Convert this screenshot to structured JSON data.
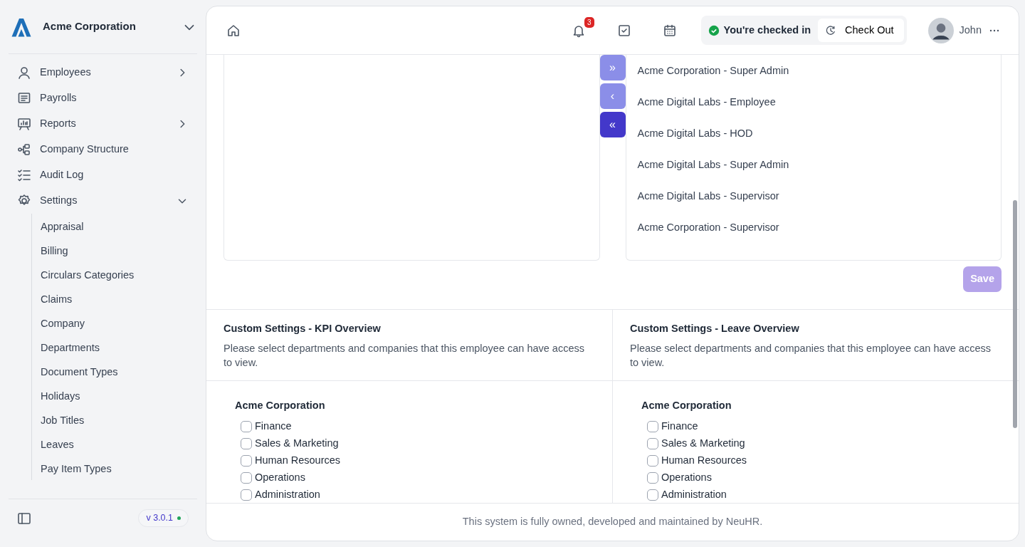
{
  "brand": {
    "name": "Acme Corporation"
  },
  "sidebar": {
    "items": [
      {
        "label": "Employees",
        "expanded": false
      },
      {
        "label": "Payrolls"
      },
      {
        "label": "Reports",
        "expanded": false
      },
      {
        "label": "Company Structure"
      },
      {
        "label": "Audit Log"
      },
      {
        "label": "Settings",
        "expanded": true,
        "children": [
          {
            "label": "Appraisal"
          },
          {
            "label": "Billing"
          },
          {
            "label": "Circulars Categories"
          },
          {
            "label": "Claims"
          },
          {
            "label": "Company"
          },
          {
            "label": "Departments"
          },
          {
            "label": "Document Types"
          },
          {
            "label": "Holidays"
          },
          {
            "label": "Job Titles"
          },
          {
            "label": "Leaves"
          },
          {
            "label": "Pay Item Types"
          }
        ]
      }
    ],
    "version": "v 3.0.1"
  },
  "header": {
    "notification_count": "3",
    "status": "You're checked in",
    "checkout_button": "Check Out",
    "user": "John"
  },
  "transfer": {
    "buttons": [
      {
        "symbol": "»",
        "disabled": true
      },
      {
        "symbol": "‹",
        "disabled": true
      },
      {
        "symbol": "«",
        "disabled": false
      }
    ],
    "assigned": [
      "Acme Corporation - Super Admin",
      "Acme Digital Labs - Employee",
      "Acme Digital Labs - HOD",
      "Acme Digital Labs - Super Admin",
      "Acme Digital Labs - Supervisor",
      "Acme Corporation - Supervisor"
    ],
    "save_button": {
      "label": "Save",
      "disabled": true
    }
  },
  "custom_settings": [
    {
      "title": "Custom Settings - KPI Overview",
      "description": "Please select departments and companies that this employee can have access to view.",
      "company": "Acme Corporation",
      "departments": [
        {
          "label": "Finance",
          "checked": false
        },
        {
          "label": "Sales & Marketing",
          "checked": false
        },
        {
          "label": "Human Resources",
          "checked": false
        },
        {
          "label": "Operations",
          "checked": false
        },
        {
          "label": "Administration",
          "checked": false
        }
      ]
    },
    {
      "title": "Custom Settings - Leave Overview",
      "description": "Please select departments and companies that this employee can have access to view.",
      "company": "Acme Corporation",
      "departments": [
        {
          "label": "Finance",
          "checked": false
        },
        {
          "label": "Sales & Marketing",
          "checked": false
        },
        {
          "label": "Human Resources",
          "checked": false
        },
        {
          "label": "Operations",
          "checked": false
        },
        {
          "label": "Administration",
          "checked": false
        }
      ]
    }
  ],
  "footer": "This system is fully owned, developed and maintained by NeuHR."
}
